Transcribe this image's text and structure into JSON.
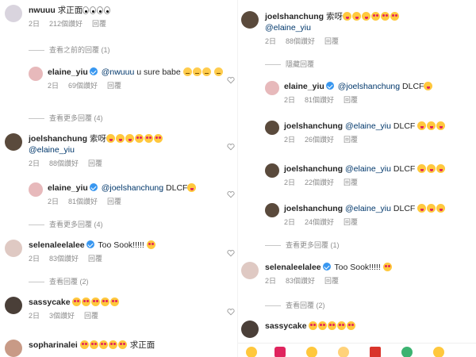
{
  "left": {
    "c1": {
      "user": "nwuuu",
      "text": "求正面",
      "date": "2日",
      "likes": "212個讚好",
      "reply": "回覆"
    },
    "v1": {
      "label": "查看之前的回覆 (1)"
    },
    "c2": {
      "user": "elaine_yiu",
      "mention": "@nwuuu",
      "text": "u sure babe",
      "date": "2日",
      "likes": "69個讚好",
      "reply": "回覆"
    },
    "v2": {
      "label": "查看更多回覆 (4)"
    },
    "c3": {
      "user": "joelshanchung",
      "text": "索呀",
      "mention": "@elaine_yiu",
      "date": "2日",
      "likes": "88個讚好",
      "reply": "回覆"
    },
    "c4": {
      "user": "elaine_yiu",
      "mention": "@joelshanchung",
      "text": "DLCF",
      "date": "2日",
      "likes": "81個讚好",
      "reply": "回覆"
    },
    "v3": {
      "label": "查看更多回覆 (4)"
    },
    "c5": {
      "user": "selenaleelalee",
      "text": "Too Sook!!!!!",
      "date": "2日",
      "likes": "83個讚好",
      "reply": "回覆"
    },
    "v4": {
      "label": "查看回覆 (2)"
    },
    "c6": {
      "user": "sassycake",
      "date": "2日",
      "likes": "3個讚好",
      "reply": "回覆"
    },
    "c7": {
      "user": "sopharinalei",
      "text": "求正面"
    }
  },
  "right": {
    "c1": {
      "user": "joelshanchung",
      "text": "索呀",
      "mention": "@elaine_yiu",
      "date": "2日",
      "likes": "88個讚好",
      "reply": "回覆"
    },
    "v1": {
      "label": "隱藏回覆"
    },
    "c2": {
      "user": "elaine_yiu",
      "mention": "@joelshanchung",
      "text": "DLCF",
      "date": "2日",
      "likes": "81個讚好",
      "reply": "回覆"
    },
    "c3": {
      "user": "joelshanchung",
      "mention": "@elaine_yiu",
      "text": "DLCF",
      "date": "2日",
      "likes": "26個讚好",
      "reply": "回覆"
    },
    "c4": {
      "user": "joelshanchung",
      "mention": "@elaine_yiu",
      "text": "DLCF",
      "date": "2日",
      "likes": "22個讚好",
      "reply": "回覆"
    },
    "c5": {
      "user": "joelshanchung",
      "mention": "@elaine_yiu",
      "text": "DLCF",
      "date": "2日",
      "likes": "24個讚好",
      "reply": "回覆"
    },
    "v2": {
      "label": "查看更多回覆 (1)"
    },
    "c6": {
      "user": "selenaleelalee",
      "text": "Too Sook!!!!!",
      "date": "2日",
      "likes": "83個讚好",
      "reply": "回覆"
    },
    "v3": {
      "label": "查看回覆 (2)"
    },
    "c7": {
      "user": "sassycake"
    }
  },
  "colors": {
    "verified": "#3897f0",
    "mention": "#00376b",
    "meta": "#8e8e8e"
  },
  "icons": {
    "like": "heart-outline-icon",
    "verified": "verified-badge-icon"
  }
}
